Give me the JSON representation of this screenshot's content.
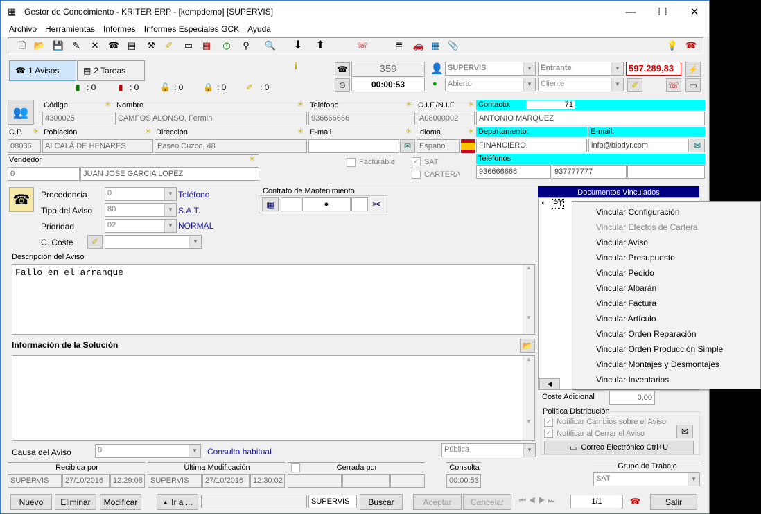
{
  "window": {
    "title": "Gestor de Conocimiento - KRITER ERP - [kempdemo] [SUPERVIS]",
    "minimize": "—",
    "maximize": "☐",
    "close": "✕"
  },
  "menu": [
    "Archivo",
    "Herramientas",
    "Informes",
    "Informes Especiales GCK",
    "Ayuda"
  ],
  "tabs": {
    "avisos": "1 Avisos",
    "tareas": "2 Tareas"
  },
  "counters": [
    ": 0",
    ": 0",
    ": 0",
    ": 0",
    ": 0"
  ],
  "status": {
    "number": "359",
    "timer": "00:00:53",
    "user": "SUPERVIS",
    "direction": "Entrante",
    "amount": "597.289,83",
    "state": "Abierto",
    "type": "Cliente"
  },
  "client": {
    "codigo_label": "Código",
    "codigo": "4300025",
    "nombre_label": "Nombre",
    "nombre": "CAMPOS ALONSO, Fermin",
    "telefono_label": "Teléfono",
    "telefono": "936666666",
    "cif_label": "C.I.F./N.I.F",
    "cif": "A08000002",
    "cp_label": "C.P.",
    "cp": "08036",
    "poblacion_label": "Población",
    "poblacion": "ALCALÁ DE HENARES",
    "direccion_label": "Dirección",
    "direccion": "Paseo Cuzco, 48",
    "email_label": "E-mail",
    "email": "",
    "idioma_label": "Idioma",
    "idioma": "Español",
    "vendedor_label": "Vendedor",
    "vendedor_code": "0",
    "vendedor_name": "JUAN JOSE GARCIA LOPEZ",
    "facturable": "Facturable",
    "sat": "SAT",
    "cartera": "CARTERA"
  },
  "contact": {
    "contacto_label": "Contacto:",
    "contacto_num": "71",
    "contacto": "ANTONIO MARQUEZ",
    "depto_label": "Departamento:",
    "depto": "FINANCIERO",
    "email_label": "E-mail:",
    "email": "info@biodyr.com",
    "tel_label": "Teléfonos",
    "tel1": "936666666",
    "tel2": "937777777",
    "tel3": ""
  },
  "aviso": {
    "procedencia_label": "Procedencia",
    "procedencia": "0",
    "procedencia_desc": "Teléfono",
    "tipo_label": "Tipo del Aviso",
    "tipo": "80",
    "tipo_desc": "S.A.T.",
    "prioridad_label": "Prioridad",
    "prioridad": "02",
    "prioridad_desc": "NORMAL",
    "coste_label": "C. Coste",
    "contrato_label": "Contrato de Mantenimiento"
  },
  "descripcion": {
    "label": "Descripción del Aviso",
    "text": "Fallo en el arranque"
  },
  "solucion": {
    "label": "Información de la Solución",
    "text": ""
  },
  "causa": {
    "label": "Causa del Aviso",
    "value": "0",
    "link": "Consulta habitual",
    "visibility": "Pública"
  },
  "docs": {
    "title": "Documentos Vinculados",
    "item": "PT"
  },
  "context_menu": [
    {
      "label": "Vincular Configuración",
      "enabled": true
    },
    {
      "label": "Vincular Efectos de Cartera",
      "enabled": false
    },
    {
      "label": "Vincular Aviso",
      "enabled": true
    },
    {
      "label": "Vincular Presupuesto",
      "enabled": true
    },
    {
      "label": "Vincular Pedido",
      "enabled": true
    },
    {
      "label": "Vincular Albarán",
      "enabled": true
    },
    {
      "label": "Vincular Factura",
      "enabled": true
    },
    {
      "label": "Vincular Artículo",
      "enabled": true
    },
    {
      "label": "Vincular Orden Reparación",
      "enabled": true
    },
    {
      "label": "Vincular Orden Producción Simple",
      "enabled": true
    },
    {
      "label": "Vincular Montajes y Desmontajes",
      "enabled": true
    },
    {
      "label": "Vincular Inventarios",
      "enabled": true
    }
  ],
  "coste": {
    "label": "Coste Adicional",
    "value": "0,00"
  },
  "politica": {
    "label": "Política Distribución",
    "opt1": "Notificar Cambios sobre el Aviso",
    "opt2": "Notificar al Cerrar el Aviso",
    "email_btn": "Correo Electrónico Ctrl+U"
  },
  "footer": {
    "recibida_label": "Recibida por",
    "recibida_user": "SUPERVIS",
    "recibida_date": "27/10/2016",
    "recibida_time": "12:29:08",
    "modif_label": "Última Modificación",
    "modif_user": "SUPERVIS",
    "modif_date": "27/10/2016",
    "modif_time": "12:30:02",
    "cerrada_label": "Cerrada por",
    "consulta_label": "Consulta",
    "consulta": "00:00:53",
    "grupo_label": "Grupo de Trabajo",
    "grupo": "SAT"
  },
  "buttons": {
    "nuevo": "Nuevo",
    "eliminar": "Eliminar",
    "modificar": "Modificar",
    "ira": "Ir a ...",
    "user": "SUPERVIS",
    "buscar": "Buscar",
    "aceptar": "Aceptar",
    "cancelar": "Cancelar",
    "page": "1/1",
    "salir": "Salir"
  }
}
